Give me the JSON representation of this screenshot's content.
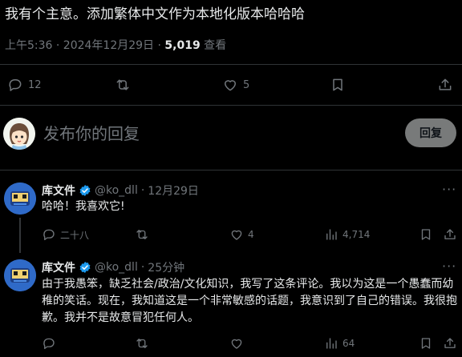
{
  "post": {
    "text": "我有个主意。添加繁体中文作为本地化版本哈哈哈",
    "meta_time": "上午5:36 · 2024年12月29日 · ",
    "views_count": "5,019",
    "views_label": " 查看"
  },
  "post_actions": {
    "reply_count": "12",
    "retweet_count": "",
    "like_count": "5"
  },
  "compose": {
    "placeholder": "发布你的回复",
    "reply_button": "回复"
  },
  "replies": [
    {
      "name": "库文件",
      "handle": "@ko_dll",
      "dot": "·",
      "time": "12月29日",
      "text": "哈哈！我喜欢它!",
      "reply_count": "二十八",
      "like_count": "4",
      "views": "4,714"
    },
    {
      "name": "库文件",
      "handle": "@ko_dll",
      "dot": "·",
      "time": "25分钟",
      "text": "由于我愚笨，缺乏社会/政治/文化知识，我写了这条评论。我以为这是一个愚蠢而幼稚的笑话。现在，我知道这是一个非常敏感的话题，我意识到了自己的错误。我很抱歉。我并不是故意冒犯任何人。",
      "reply_count": "",
      "like_count": "",
      "views": "64"
    }
  ],
  "colors": {
    "background": "#000000",
    "text": "#e7e9ea",
    "muted": "#71767b",
    "divider": "#2f3336",
    "verified": "#1d9bf0",
    "reply_button": "#787a7a"
  }
}
